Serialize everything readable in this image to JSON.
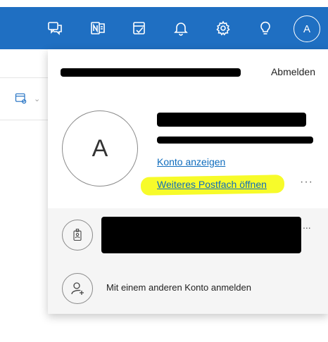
{
  "topbar": {
    "icons": [
      "chat-feedback-icon",
      "onenote-icon",
      "tasks-icon",
      "bell-icon",
      "gear-icon",
      "lightbulb-icon"
    ],
    "avatar_initial": "A",
    "color": "#1f6fc2"
  },
  "account_panel": {
    "sign_out_label": "Abmelden",
    "avatar_initial": "A",
    "view_account_label": "Konto anzeigen",
    "open_mailbox_label": "Weiteres Postfach öffnen",
    "more_label": "···",
    "highlight_color": "#f7fb2a",
    "link_color": "#0f6cbd"
  },
  "second_account": {
    "more_label": "..."
  },
  "add_account": {
    "label": "Mit einem anderen Konto anmelden"
  }
}
